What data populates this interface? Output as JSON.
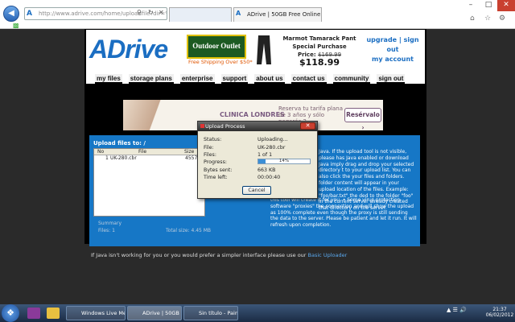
{
  "browser": {
    "url": "http://www.adrive.com/home/uploadfile?dir=%2F",
    "tabs": [
      {
        "label": "ADrive | 50GB Free Online S..."
      }
    ],
    "icons": {
      "back": "back-arrow-icon",
      "forward": "forward-arrow-icon",
      "home": "home-icon",
      "favorites": "star-icon",
      "tools": "gear-icon"
    }
  },
  "header": {
    "logo": "ADrive",
    "ad_brand": "Outdoor Outlet",
    "ad_shipping": "Free Shipping Over $50*",
    "promo_title": "Marmot Tamarack Pant Special Purchase",
    "promo_price_label": "Price:",
    "promo_old_price": "$169.99",
    "promo_new_price": "$118.99",
    "account_links": [
      "upgrade",
      "sign out",
      "my account"
    ]
  },
  "nav": [
    "my files",
    "storage plans",
    "enterprise",
    "support",
    "about us",
    "contact us",
    "community",
    "sign out"
  ],
  "ad": {
    "brand": "CLINICA LONDRES",
    "tagline": "Reserva tu tarifa plana de 3 años y sólo pagarás 2",
    "button": "Resérvalo ›"
  },
  "upload": {
    "title": "Upload files to: /",
    "columns": [
      "No",
      "File",
      "Size"
    ],
    "rows": [
      {
        "no": "1",
        "file": "UK-280.cbr",
        "size": "4557"
      }
    ],
    "summary_label": "Summary",
    "files_label": "Files: 1",
    "total_label": "Total size: 4.45 MB",
    "help_top": "Java. If the upload tool is not visible, please has Java enabled or download Java imply drag and drop your selected directory t to your upload list. You can also click the your files and folders. folder content will appear in your upload location of the files. Example: \"foo/bar.txt\" the ded to the folder \"foo\" in the current server already created that directory on the server.",
    "help_bottom": "this tool will create it for you. • Some virus protection software \"proxies\" the connection and will show the upload as 100% complete even though the proxy is still sending the data to the server. Please be patient and let it run. It will refresh upon completion.",
    "basic_text": "If Java isn't working for you or you would prefer a simpler interface please use our",
    "basic_link": "Basic Uploader"
  },
  "dialog": {
    "title": "Upload Process",
    "fields": [
      {
        "label": "Status:",
        "value": "Uploading..."
      },
      {
        "label": "File:",
        "value": "UK-280.cbr"
      },
      {
        "label": "Files:",
        "value": "1 of 1"
      },
      {
        "label": "Progress:",
        "value": ""
      },
      {
        "label": "Bytes sent:",
        "value": "663 KB"
      },
      {
        "label": "Time left:",
        "value": "00:00:40"
      }
    ],
    "progress_text": "14%",
    "progress": 0.14,
    "cancel": "Cancel"
  },
  "taskbar": {
    "tasks": [
      "Windows Live Me...",
      "ADrive | 50GB Free...",
      "Sin título - Paint"
    ],
    "time": "21:37",
    "date": "06/02/2012"
  },
  "colors": {
    "brand_blue": "#1677c6",
    "logo_blue": "#1b6ec2",
    "page_bg": "#000000"
  }
}
